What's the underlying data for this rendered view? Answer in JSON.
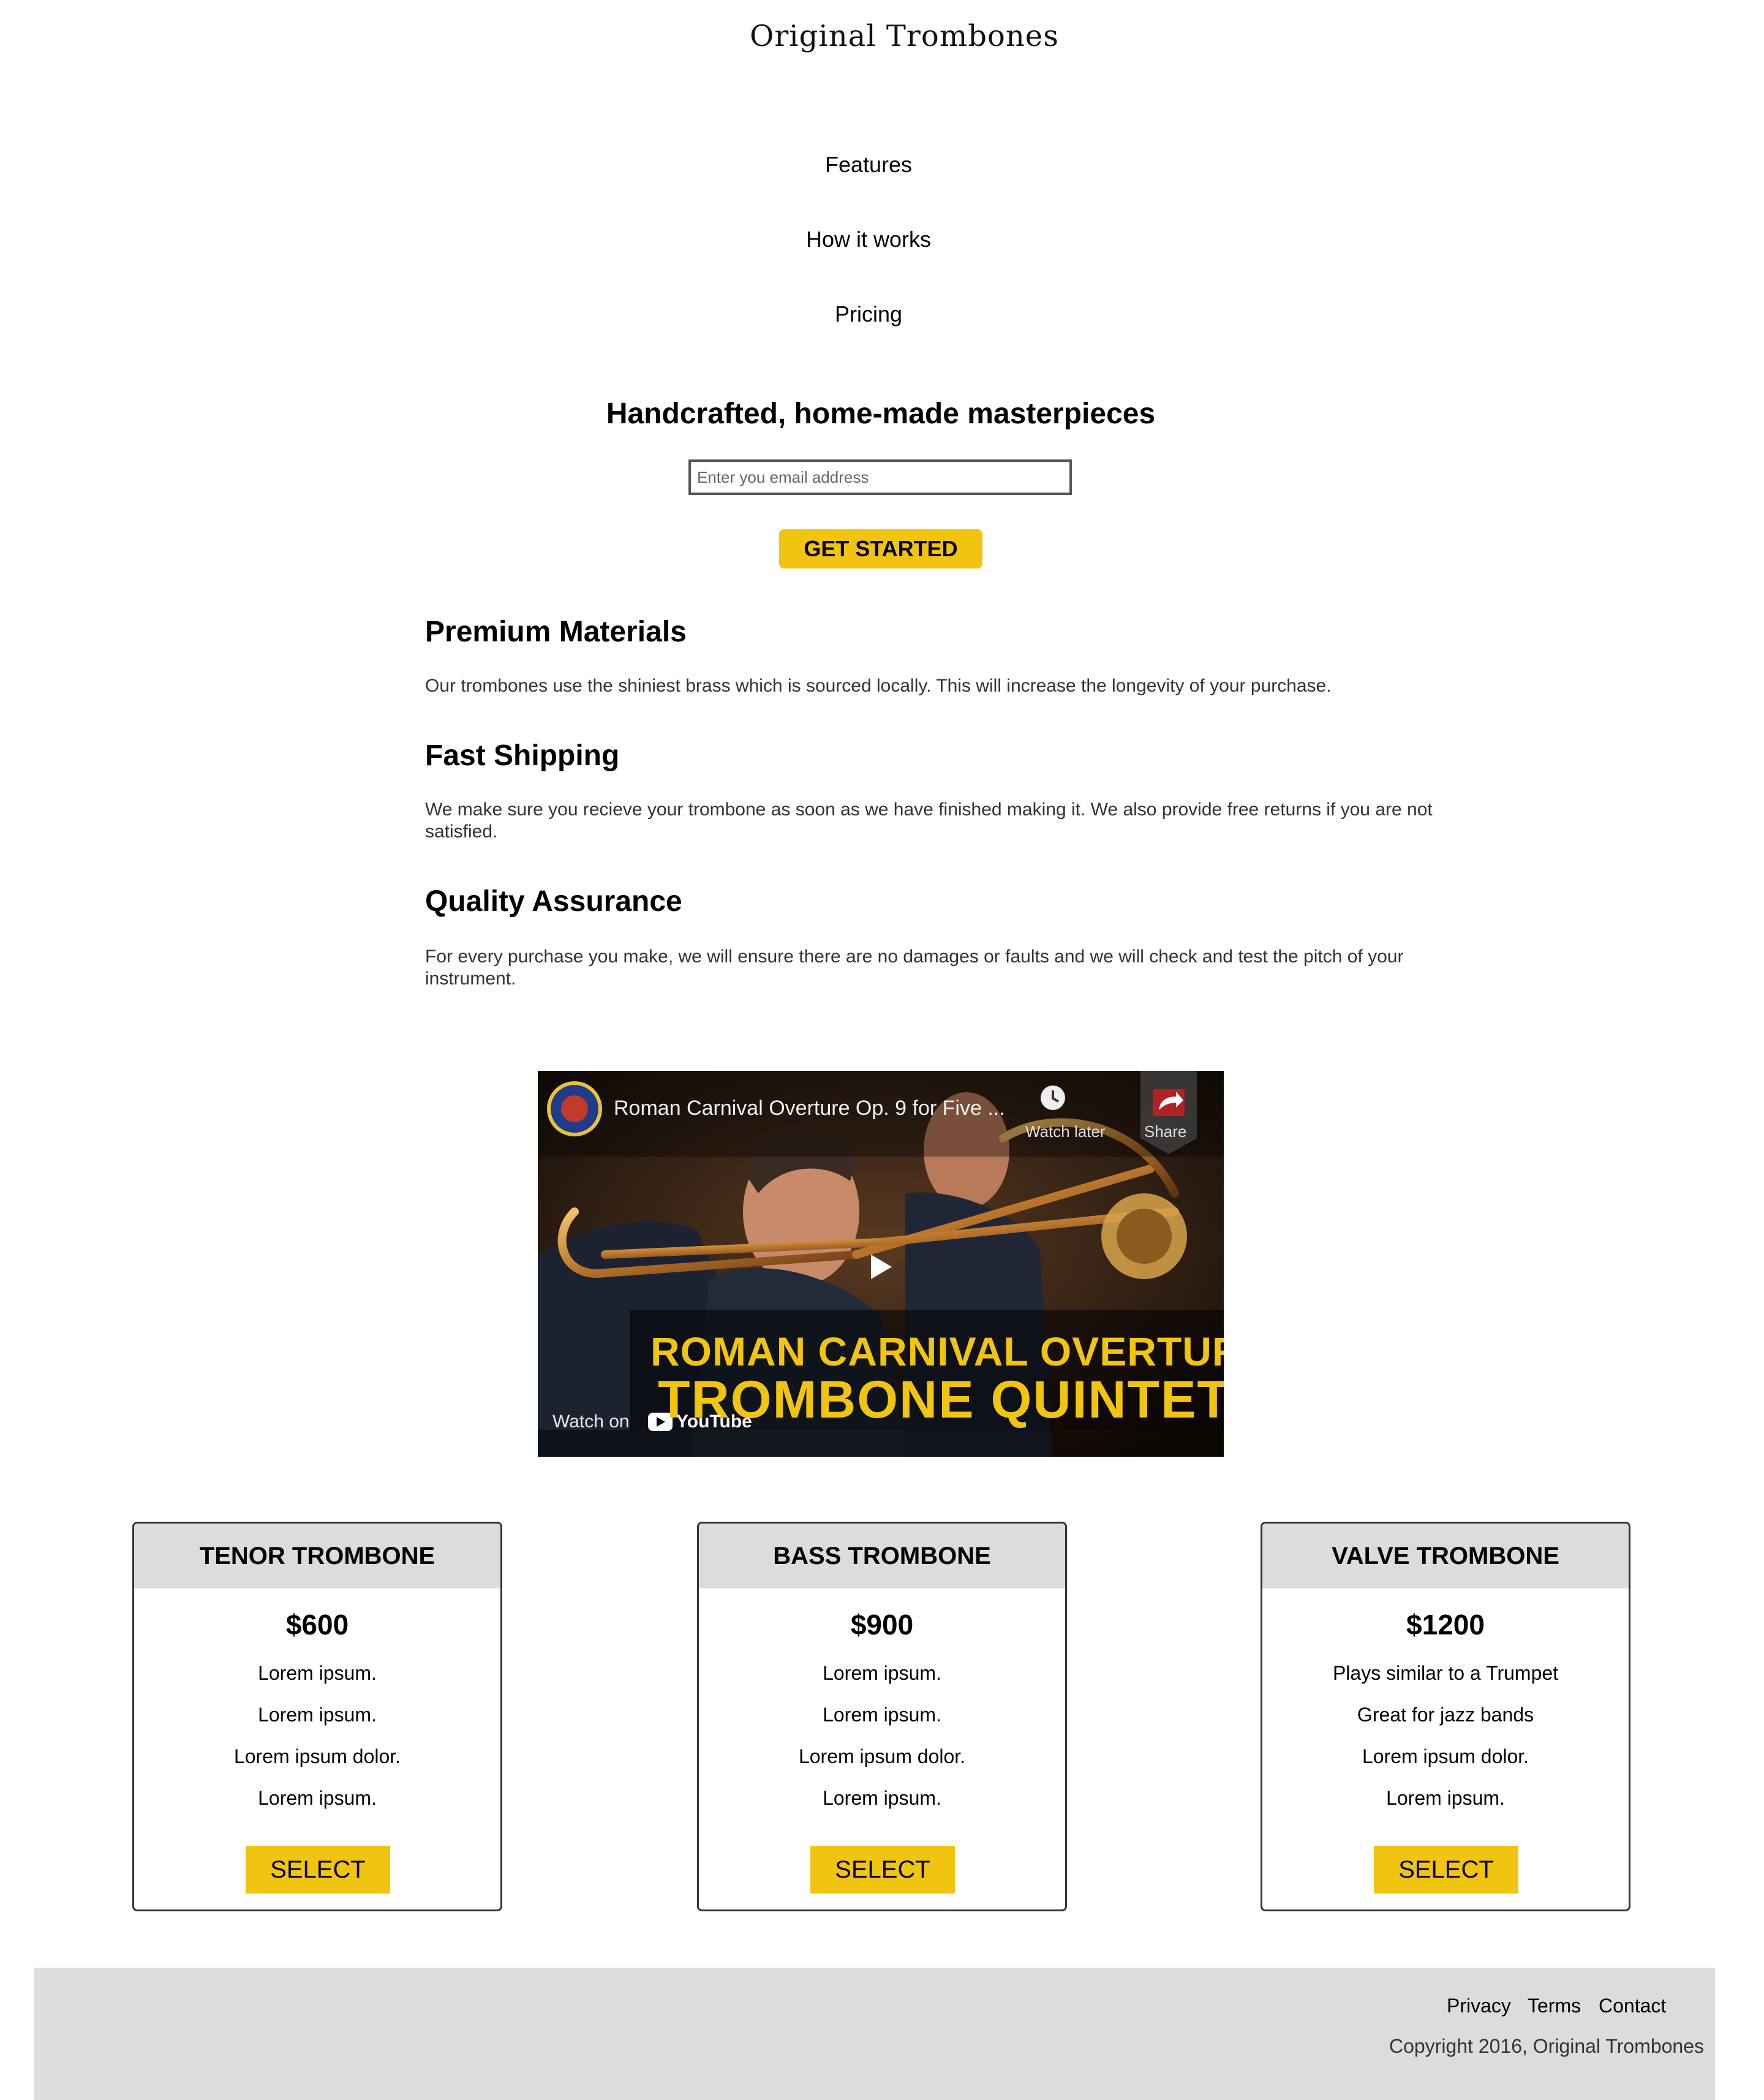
{
  "header": {
    "brand": "Original Trombones",
    "logo_icon": "trombone-logo-icon"
  },
  "nav": {
    "items": [
      "Features",
      "How it works",
      "Pricing"
    ]
  },
  "hero": {
    "title": "Handcrafted, home-made masterpieces",
    "email_placeholder": "Enter you email address",
    "email_value": "",
    "cta_label": "GET STARTED"
  },
  "features": [
    {
      "title": "Premium Materials",
      "desc": "Our trombones use the shiniest brass which is sourced locally. This will increase the longevity of your purchase."
    },
    {
      "title": "Fast Shipping",
      "desc": "We make sure you recieve your trombone as soon as we have finished making it. We also provide free returns if you are not satisfied."
    },
    {
      "title": "Quality Assurance",
      "desc": "For every purchase you make, we will ensure there are no damages or faults and we will check and test the pitch of your instrument."
    }
  ],
  "video": {
    "title": "Roman Carnival Overture Op. 9 for Five ...",
    "watch_later": "Watch later",
    "share": "Share",
    "overlay_line1": "ROMAN CARNIVAL OVERTURE",
    "overlay_line2": "TROMBONE QUINTET",
    "watch_on": "Watch on",
    "youtube": "YouTube"
  },
  "pricing": [
    {
      "name": "TENOR TROMBONE",
      "price": "$600",
      "features": [
        "Lorem ipsum.",
        "Lorem ipsum.",
        "Lorem ipsum dolor.",
        "Lorem ipsum."
      ],
      "button": "SELECT"
    },
    {
      "name": "BASS TROMBONE",
      "price": "$900",
      "features": [
        "Lorem ipsum.",
        "Lorem ipsum.",
        "Lorem ipsum dolor.",
        "Lorem ipsum."
      ],
      "button": "SELECT"
    },
    {
      "name": "VALVE TROMBONE",
      "price": "$1200",
      "features": [
        "Plays similar to a Trumpet",
        "Great for jazz bands",
        "Lorem ipsum dolor.",
        "Lorem ipsum."
      ],
      "button": "SELECT"
    }
  ],
  "footer": {
    "links": [
      "Privacy",
      "Terms",
      "Contact"
    ],
    "copyright": "Copyright 2016, Original Trombones"
  },
  "colors": {
    "accent": "#f1c40f",
    "panel_gray": "#dcdcdc"
  }
}
